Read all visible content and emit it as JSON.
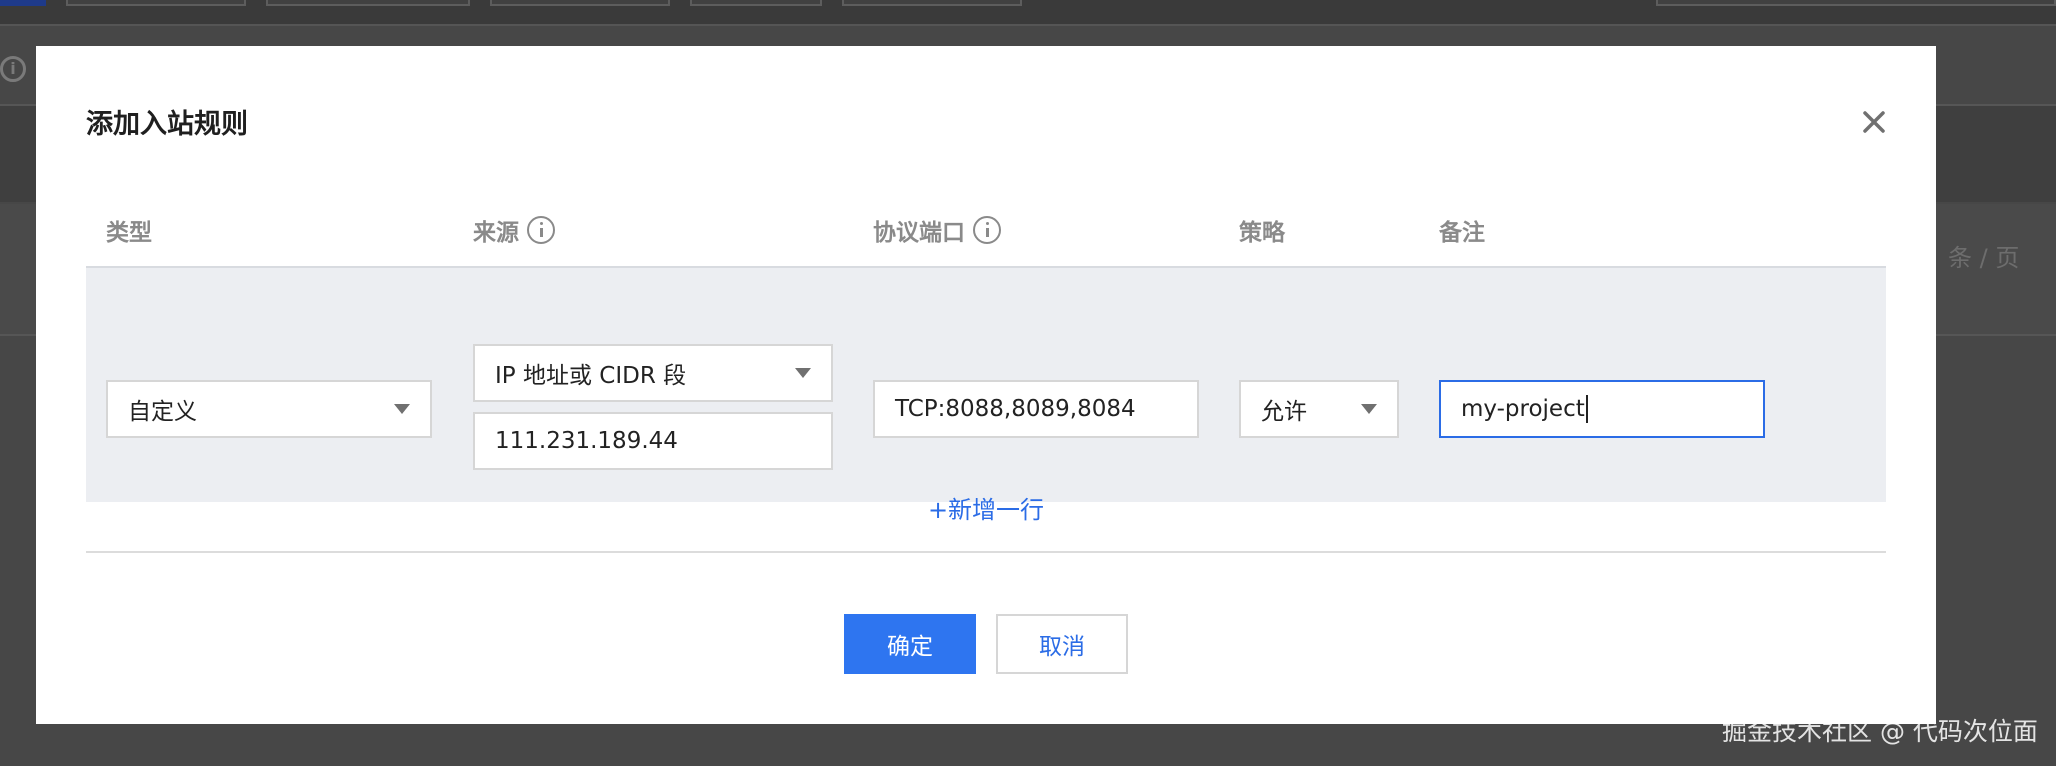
{
  "background": {
    "pager_text": "条 / 页",
    "info_icon_glyph": "i"
  },
  "dialog": {
    "title": "添加入站规则",
    "close_icon": "close-icon"
  },
  "columns": {
    "type": "类型",
    "source": "来源",
    "port": "协议端口",
    "policy": "策略",
    "note": "备注"
  },
  "rule": {
    "type_value": "自定义",
    "source_type": "IP 地址或 CIDR 段",
    "source_value": "111.231.189.44",
    "port_value": "TCP:8088,8089,8084",
    "policy_value": "允许",
    "note_value": "my-project"
  },
  "actions": {
    "add_row": "+新增一行",
    "confirm": "确定",
    "cancel": "取消"
  },
  "watermark": "掘金技术社区 @ 代码次位面",
  "colors": {
    "primary": "#2e75f0",
    "focus_border": "#2b6ce6",
    "row_bg": "#eceef2",
    "overlay": "#474747"
  }
}
